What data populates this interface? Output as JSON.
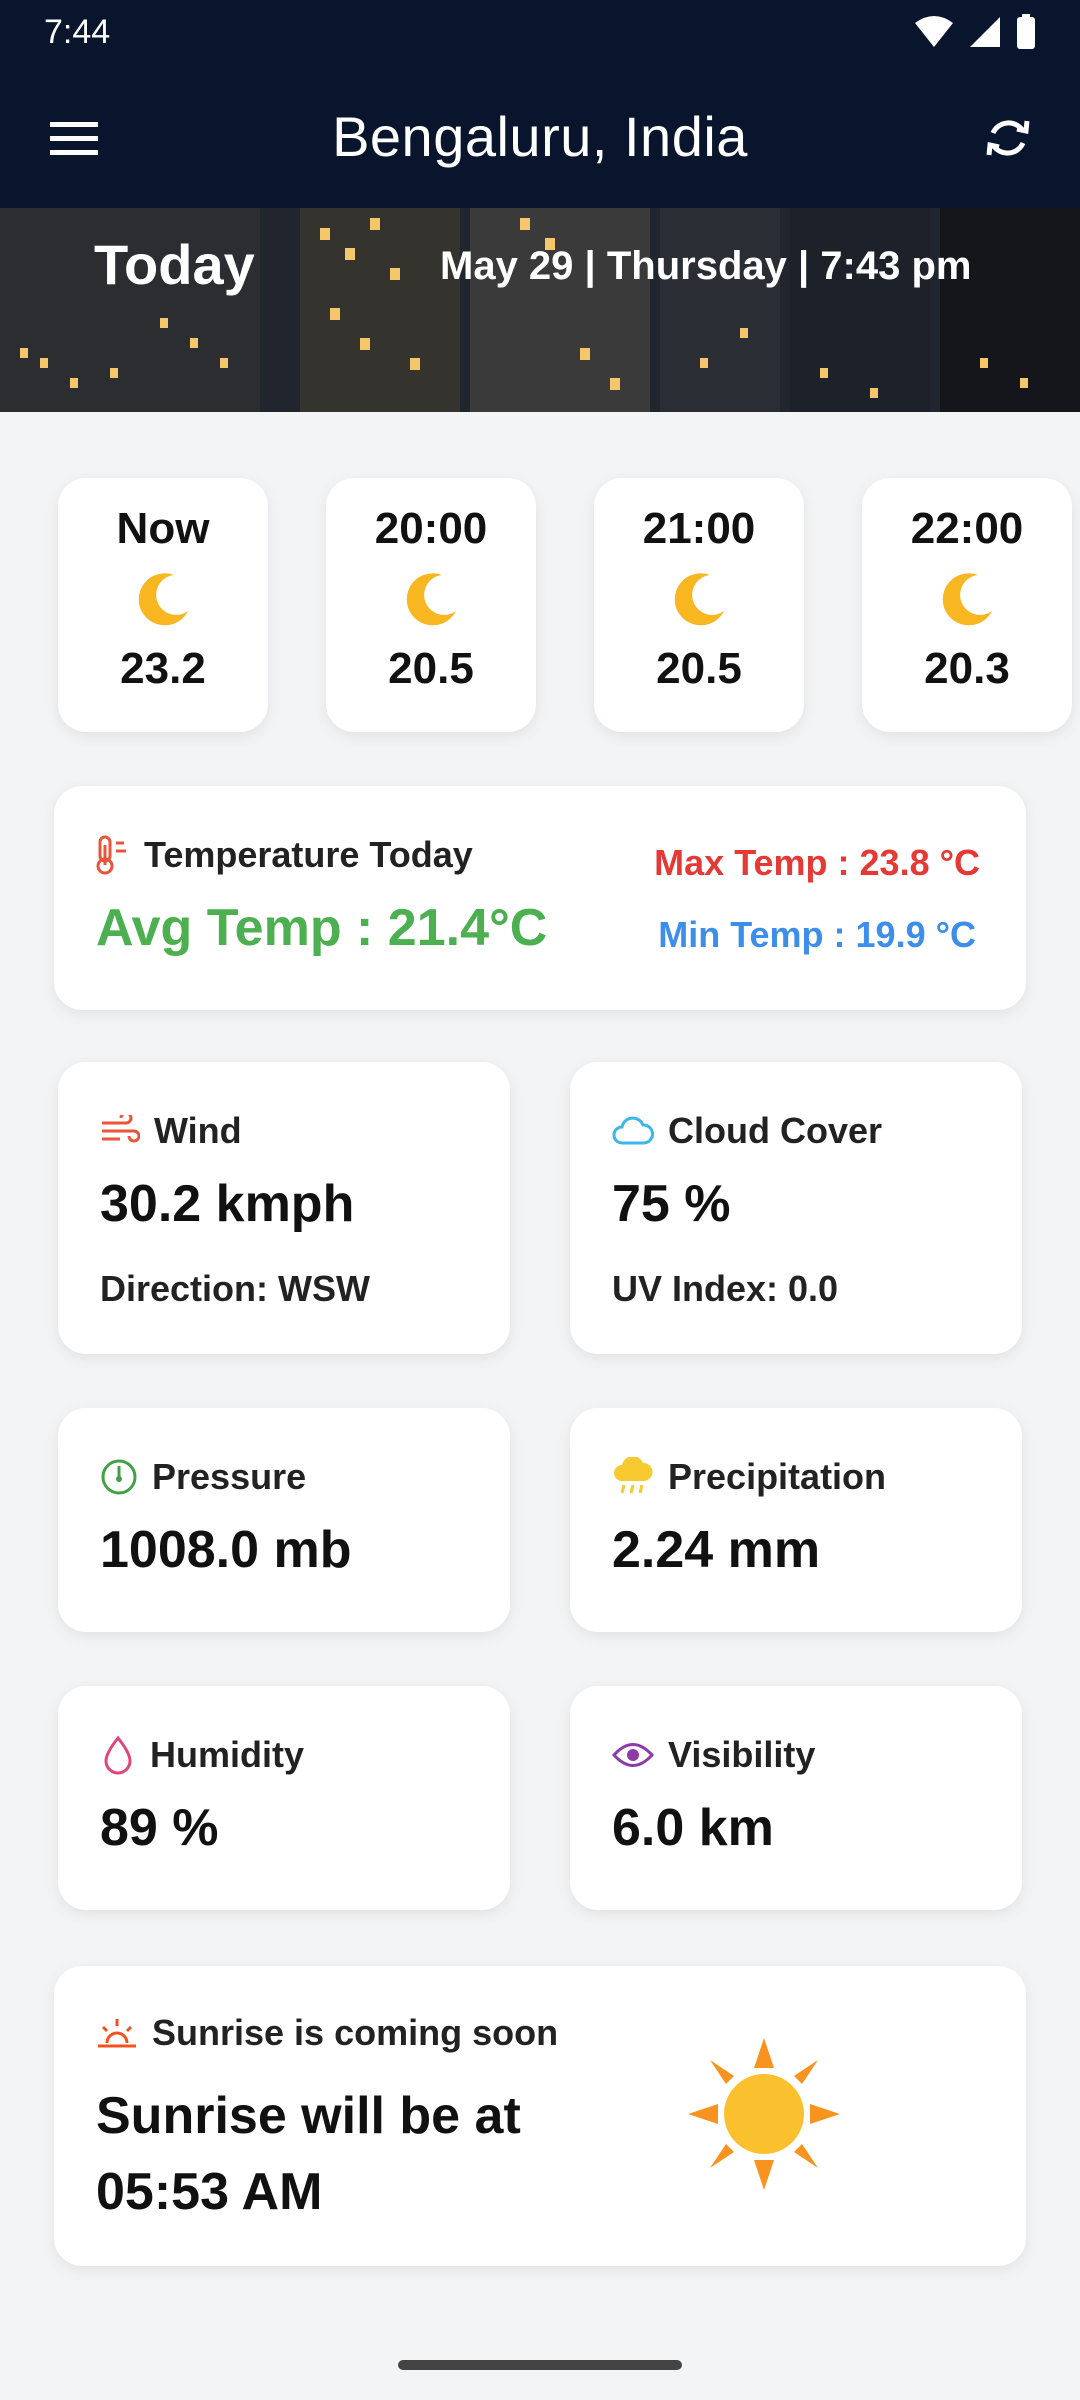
{
  "status_bar": {
    "time": "7:44"
  },
  "app_bar": {
    "title": "Bengaluru, India"
  },
  "banner": {
    "today": "Today",
    "date_line": "May 29 | Thursday | 7:43 pm"
  },
  "hourly": [
    {
      "time": "Now",
      "temp": "23.2"
    },
    {
      "time": "20:00",
      "temp": "20.5"
    },
    {
      "time": "21:00",
      "temp": "20.5"
    },
    {
      "time": "22:00",
      "temp": "20.3"
    }
  ],
  "temperature": {
    "label": "Temperature Today",
    "avg": "Avg Temp : 21.4°C",
    "max": "Max Temp : 23.8 °C",
    "min": "Min Temp : 19.9 °C"
  },
  "wind": {
    "label": "Wind",
    "value": "30.2 kmph",
    "sub": "Direction: WSW"
  },
  "cloud": {
    "label": "Cloud Cover",
    "value": "75 %",
    "sub": "UV Index: 0.0"
  },
  "pressure": {
    "label": "Pressure",
    "value": "1008.0 mb"
  },
  "precipitation": {
    "label": "Precipitation",
    "value": "2.24 mm"
  },
  "humidity": {
    "label": "Humidity",
    "value": "89 %"
  },
  "visibility": {
    "label": "Visibility",
    "value": "6.0 km"
  },
  "sunrise": {
    "label": "Sunrise is coming soon",
    "main": "Sunrise will be at 05:53 AM"
  },
  "colors": {
    "app_bar": "#08152d",
    "avg_temp": "#4caf50",
    "max_temp": "#e53935",
    "min_temp": "#3d8ee8"
  },
  "icons": {
    "menu": "hamburger-menu-icon",
    "refresh": "refresh-icon",
    "moon": "crescent-moon-icon",
    "thermometer": "thermometer-icon",
    "wind": "wind-icon",
    "cloud": "cloud-icon",
    "pressure": "gauge-icon",
    "precipitation": "rain-cloud-icon",
    "humidity": "water-drop-icon",
    "visibility": "eye-icon",
    "sunrise": "sunrise-icon",
    "sun": "sun-icon"
  }
}
